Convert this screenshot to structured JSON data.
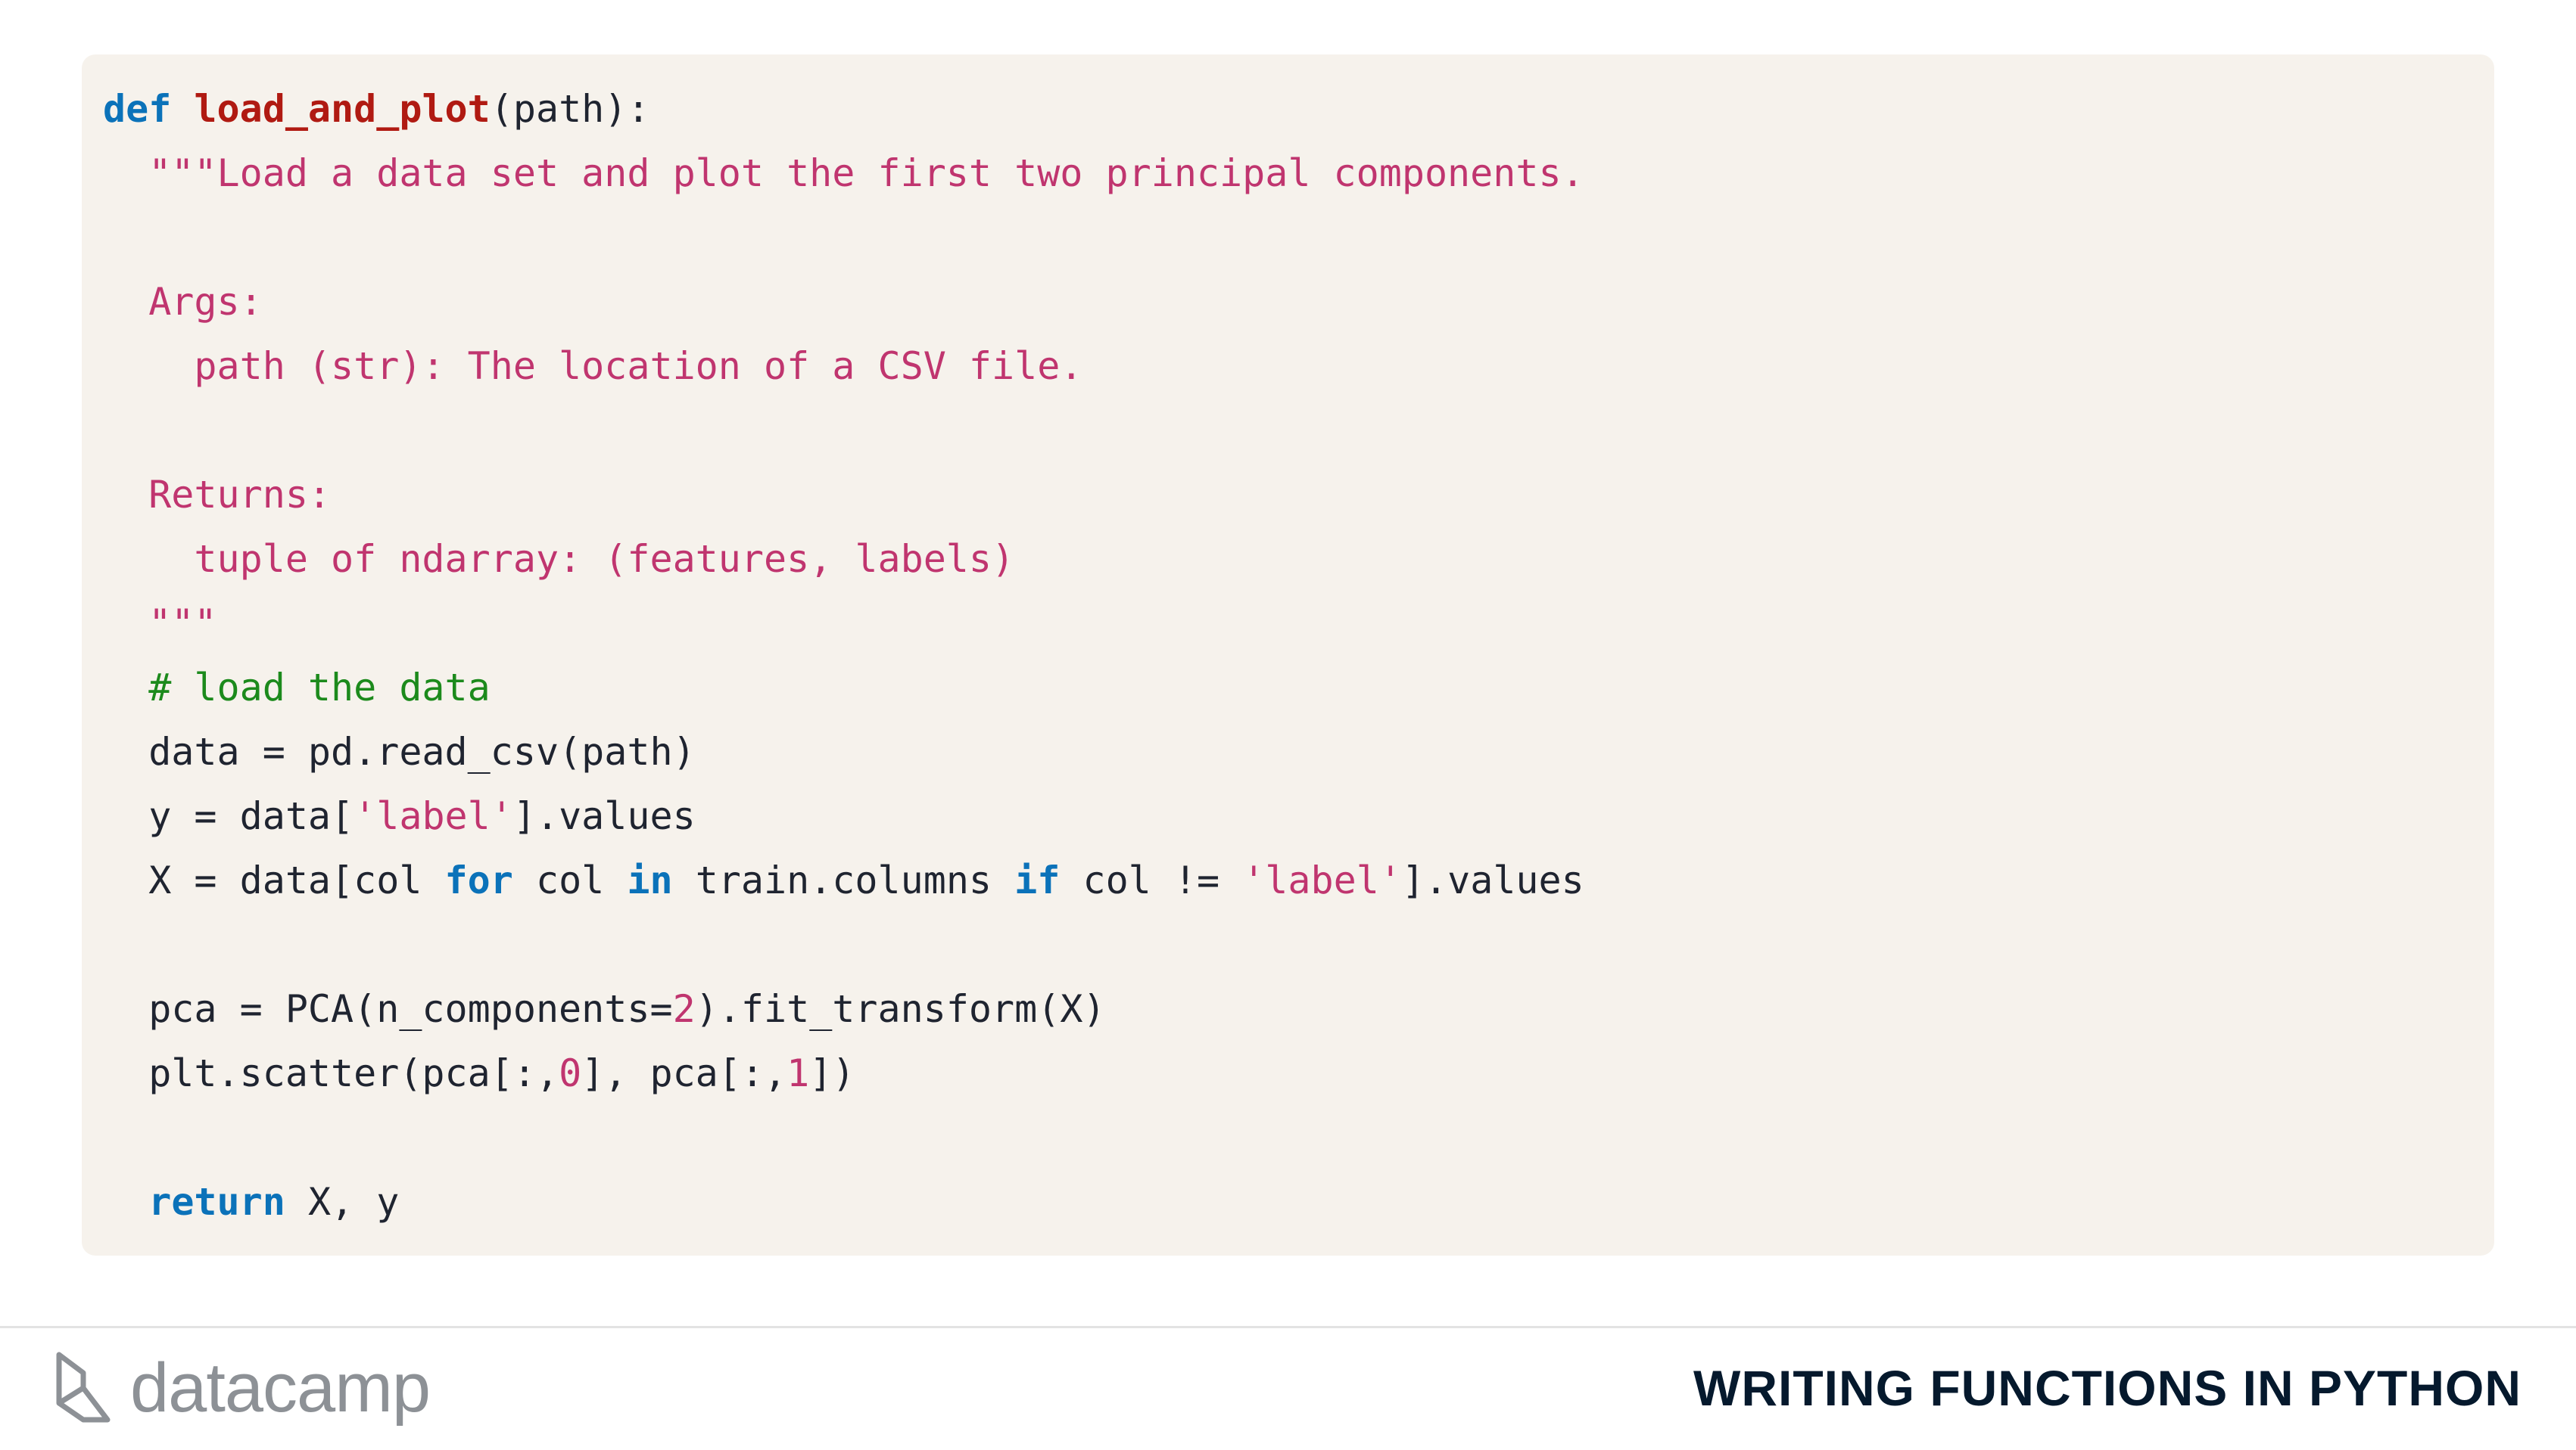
{
  "code": {
    "language": "python",
    "lines": [
      [
        {
          "t": "kw",
          "v": "def"
        },
        {
          "t": "plain",
          "v": " "
        },
        {
          "t": "fn",
          "v": "load_and_plot"
        },
        {
          "t": "plain",
          "v": "(path):"
        }
      ],
      [
        {
          "t": "str",
          "v": "  \"\"\"Load a data set and plot the first two principal components."
        }
      ],
      [],
      [
        {
          "t": "str",
          "v": "  Args:"
        }
      ],
      [
        {
          "t": "str",
          "v": "    path (str): The location of a CSV file."
        }
      ],
      [],
      [
        {
          "t": "str",
          "v": "  Returns:"
        }
      ],
      [
        {
          "t": "str",
          "v": "    tuple of ndarray: (features, labels)"
        }
      ],
      [
        {
          "t": "str",
          "v": "  \"\"\""
        }
      ],
      [
        {
          "t": "cmt",
          "v": "  # load the data"
        }
      ],
      [
        {
          "t": "plain",
          "v": "  data = pd.read_csv(path)"
        }
      ],
      [
        {
          "t": "plain",
          "v": "  y = data["
        },
        {
          "t": "str",
          "v": "'label'"
        },
        {
          "t": "plain",
          "v": "].values"
        }
      ],
      [
        {
          "t": "plain",
          "v": "  X = data[col "
        },
        {
          "t": "kw",
          "v": "for"
        },
        {
          "t": "plain",
          "v": " col "
        },
        {
          "t": "kw",
          "v": "in"
        },
        {
          "t": "plain",
          "v": " train.columns "
        },
        {
          "t": "kw",
          "v": "if"
        },
        {
          "t": "plain",
          "v": " col != "
        },
        {
          "t": "str",
          "v": "'label'"
        },
        {
          "t": "plain",
          "v": "].values"
        }
      ],
      [],
      [
        {
          "t": "plain",
          "v": "  pca = PCA(n_components="
        },
        {
          "t": "num",
          "v": "2"
        },
        {
          "t": "plain",
          "v": ").fit_transform(X)"
        }
      ],
      [
        {
          "t": "plain",
          "v": "  plt.scatter(pca[:,"
        },
        {
          "t": "num",
          "v": "0"
        },
        {
          "t": "plain",
          "v": "], pca[:,"
        },
        {
          "t": "num",
          "v": "1"
        },
        {
          "t": "plain",
          "v": "])"
        }
      ],
      [],
      [
        {
          "t": "plain",
          "v": "  "
        },
        {
          "t": "kw",
          "v": "return"
        },
        {
          "t": "plain",
          "v": " X, y"
        }
      ]
    ]
  },
  "footer": {
    "brand": "datacamp",
    "course_title": "WRITING FUNCTIONS IN PYTHON",
    "logo_icon": "datacamp-logo-icon"
  },
  "colors": {
    "panel_background": "#f6f2ec",
    "keyword": "#0b72b9",
    "function_name": "#b01a12",
    "string": "#c0356f",
    "comment": "#1c8a1c",
    "text": "#1f2430",
    "footer_title": "#05192d",
    "logo": "#8d9196"
  }
}
